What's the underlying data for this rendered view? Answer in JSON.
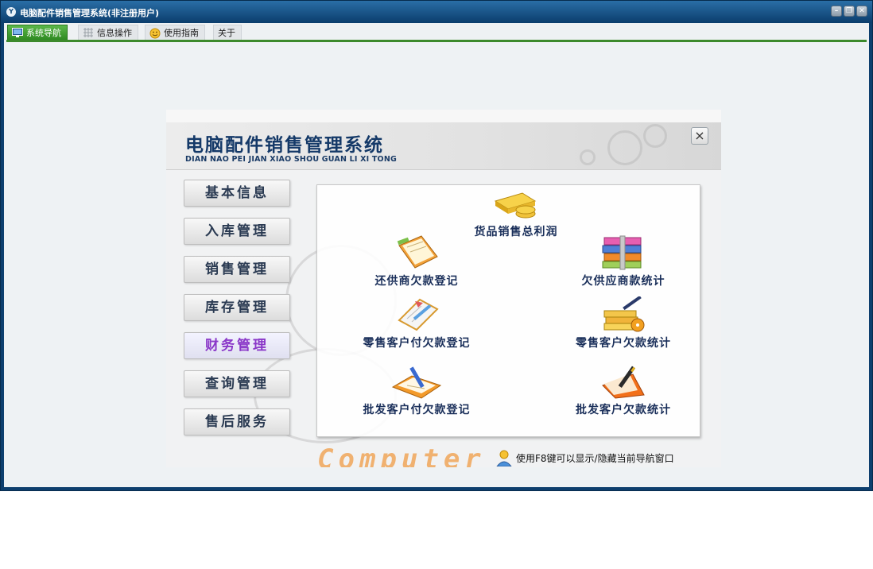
{
  "window": {
    "title": "电脑配件销售管理系统(非注册用户)"
  },
  "tabs": [
    {
      "label": "系统导航",
      "icon": "monitor-icon"
    },
    {
      "label": "信息操作",
      "icon": "grid-icon"
    },
    {
      "label": "使用指南",
      "icon": "smiley-icon"
    },
    {
      "label": "关于"
    }
  ],
  "panel": {
    "title": "电脑配件销售管理系统",
    "pinyin": "DIAN NAO PEI JIAN XIAO SHOU GUAN LI XI TONG",
    "close": "×",
    "nav": [
      "基本信息",
      "入库管理",
      "销售管理",
      "库存管理",
      "财务管理",
      "查询管理",
      "售后服务"
    ],
    "selected_nav": "财务管理",
    "items": [
      {
        "label": "货品销售总利润",
        "icon": "gold-coins-icon"
      },
      {
        "label": "还供商欠款登记",
        "icon": "notebook-icon"
      },
      {
        "label": "欠供应商款统计",
        "icon": "books-icon"
      },
      {
        "label": "零售客户付欠款登记",
        "icon": "notepad-pencil-icon"
      },
      {
        "label": "零售客户欠款统计",
        "icon": "cd-books-icon"
      },
      {
        "label": "批发客户付欠款登记",
        "icon": "binder-pen-icon"
      },
      {
        "label": "批发客户欠款统计",
        "icon": "folder-pen-icon"
      }
    ],
    "brand": "Computer",
    "hint": "使用F8键可以显示/隐藏当前导航窗口"
  }
}
